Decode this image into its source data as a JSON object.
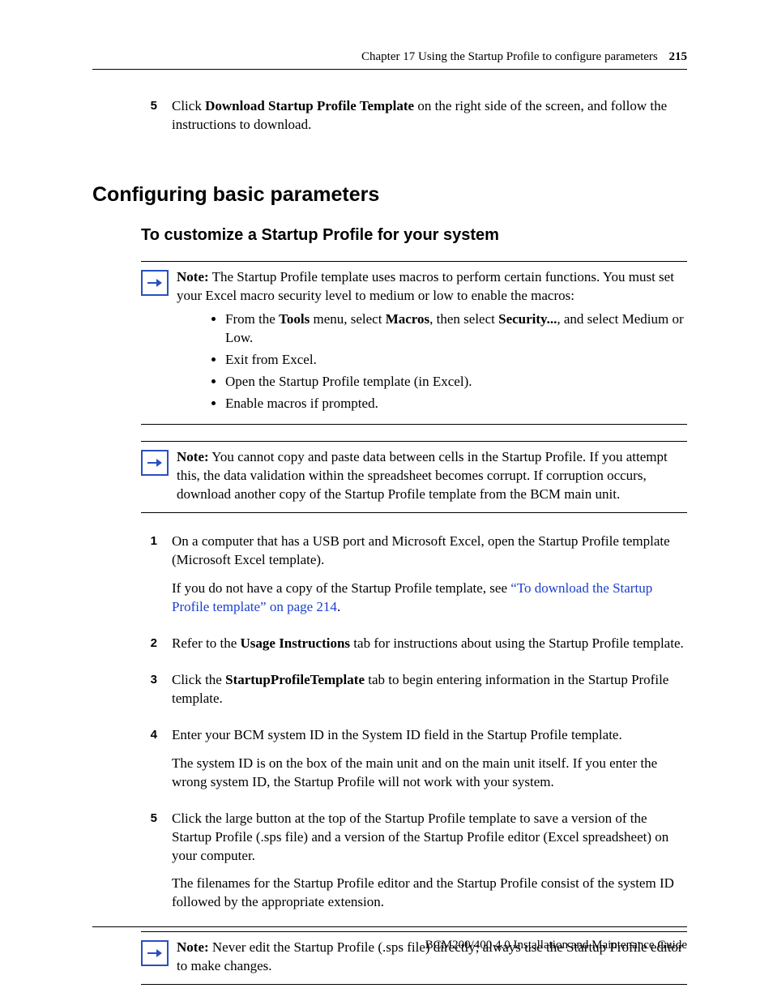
{
  "header": {
    "chapter": "Chapter 17  Using the Startup Profile to configure parameters",
    "page": "215"
  },
  "footer": {
    "text": "BCM200/400 4.0 Installation and Maintenance Guide"
  },
  "topStep": {
    "num": "5",
    "pre": "Click ",
    "bold": "Download Startup Profile Template",
    "post": " on the right side of the screen, and follow the instructions to download."
  },
  "h1": "Configuring basic parameters",
  "h2": "To customize a Startup Profile for your system",
  "note1": {
    "label": "Note:",
    "intro": " The Startup Profile template uses macros to perform certain functions. You must set your Excel macro security level to medium or low to enable the macros:",
    "bullets": {
      "b1_pre": "From the ",
      "b1_bold1": "Tools",
      "b1_mid1": " menu, select ",
      "b1_bold2": "Macros",
      "b1_mid2": ", then select ",
      "b1_bold3": "Security...",
      "b1_post": ", and select Medium or Low.",
      "b2": "Exit from Excel.",
      "b3": "Open the Startup Profile template (in Excel).",
      "b4": "Enable macros if prompted."
    }
  },
  "note2": {
    "label": "Note:",
    "text": " You cannot copy and paste data between cells in the Startup Profile. If you attempt this, the data validation within the spreadsheet becomes corrupt. If corruption occurs, download another copy of the Startup Profile template from the BCM main unit."
  },
  "steps": {
    "s1": {
      "num": "1",
      "p1": "On a computer that has a USB port and Microsoft Excel, open the Startup Profile template (Microsoft Excel template).",
      "p2_pre": "If you do not have a copy of the Startup Profile template, see ",
      "p2_link": "“To download the Startup Profile template” on page 214",
      "p2_post": "."
    },
    "s2": {
      "num": "2",
      "pre": "Refer to the ",
      "bold": "Usage Instructions",
      "post": " tab for instructions about using the Startup Profile template."
    },
    "s3": {
      "num": "3",
      "pre": "Click the ",
      "bold": "StartupProfileTemplate",
      "post": " tab to begin entering information in the Startup Profile template."
    },
    "s4": {
      "num": "4",
      "p1": "Enter your BCM system ID in the System ID field in the Startup Profile template.",
      "p2": "The system ID is on the box of the main unit and on the main unit itself. If you enter the wrong system ID, the Startup Profile will not work with your system."
    },
    "s5": {
      "num": "5",
      "p1": "Click the large button at the top of the Startup Profile template to save a version of the Startup Profile (.sps file) and a version of the Startup Profile editor (Excel spreadsheet) on your computer.",
      "p2": "The filenames for the Startup Profile editor and the Startup Profile consist of the system ID followed by the appropriate extension."
    }
  },
  "note3": {
    "label": "Note:",
    "text": " Never edit the Startup Profile (.sps file) directly; always use the Startup Profile editor to make changes."
  }
}
